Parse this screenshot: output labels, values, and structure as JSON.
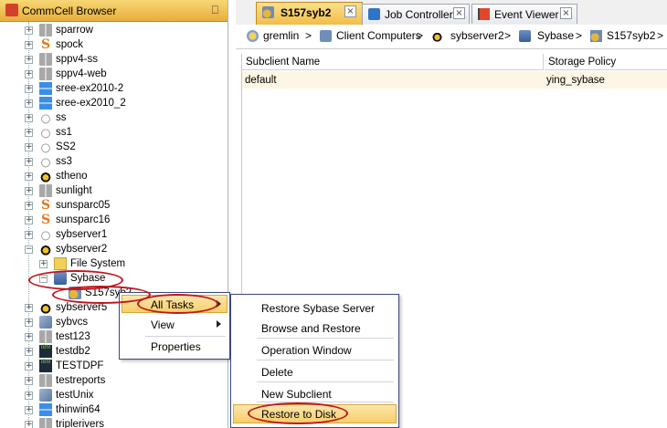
{
  "left_panel": {
    "title": "CommCell Browser",
    "pin": "⎕",
    "tree": [
      {
        "label": "sparrow",
        "icon": "grey-windows-icon"
      },
      {
        "label": "spock",
        "icon": "solaris-icon"
      },
      {
        "label": "sppv4-ss",
        "icon": "grey-windows-icon"
      },
      {
        "label": "sppv4-web",
        "icon": "grey-windows-icon"
      },
      {
        "label": "sree-ex2010-2",
        "icon": "windows-icon"
      },
      {
        "label": "sree-ex2010_2",
        "icon": "windows-icon"
      },
      {
        "label": "ss",
        "icon": "linux-grey-icon"
      },
      {
        "label": "ss1",
        "icon": "linux-grey-icon"
      },
      {
        "label": "SS2",
        "icon": "linux-grey-icon"
      },
      {
        "label": "ss3",
        "icon": "linux-grey-icon"
      },
      {
        "label": "stheno",
        "icon": "linux-icon"
      },
      {
        "label": "sunlight",
        "icon": "grey-windows-icon"
      },
      {
        "label": "sunsparc05",
        "icon": "solaris-icon"
      },
      {
        "label": "sunsparc16",
        "icon": "solaris-icon"
      },
      {
        "label": "sybserver1",
        "icon": "linux-grey-icon"
      },
      {
        "label": "sybserver2",
        "icon": "linux-icon"
      },
      {
        "label": "File System",
        "icon": "folder-icon"
      },
      {
        "label": "Sybase",
        "icon": "database-icon"
      },
      {
        "label": "S157syb2",
        "icon": "subclient-icon"
      },
      {
        "label": "sybserver5",
        "icon": "linux-icon"
      },
      {
        "label": "sybvcs",
        "icon": "network-icon"
      },
      {
        "label": "test123",
        "icon": "grey-windows-icon"
      },
      {
        "label": "testdb2",
        "icon": "ibm-icon"
      },
      {
        "label": "TESTDPF",
        "icon": "ibm-icon"
      },
      {
        "label": "testreports",
        "icon": "grey-windows-icon"
      },
      {
        "label": "testUnix",
        "icon": "network-icon"
      },
      {
        "label": "thinwin64",
        "icon": "windows-icon"
      },
      {
        "label": "triplerivers",
        "icon": "grey-windows-icon"
      }
    ]
  },
  "tabs": [
    {
      "label": "S157syb2",
      "icon": "subclient-icon",
      "active": true
    },
    {
      "label": "Job Controller",
      "icon": "play-icon",
      "active": false
    },
    {
      "label": "Event Viewer",
      "icon": "flag-icon",
      "active": false
    }
  ],
  "tab_close": "×",
  "breadcrumb": {
    "items": [
      "gremlin",
      "Client Computers",
      "sybserver2",
      "Sybase",
      "S157syb2"
    ],
    "separator": ">"
  },
  "table": {
    "columns": [
      "Subclient Name",
      "Storage Policy"
    ],
    "rows": [
      [
        "default",
        "ying_sybase"
      ]
    ]
  },
  "context_menu": {
    "items": [
      "All Tasks",
      "View",
      "Properties"
    ]
  },
  "submenu": {
    "items": [
      "Restore Sybase Server",
      "Browse and Restore",
      "Operation Window",
      "Delete",
      "New Subclient",
      "Restore to Disk"
    ]
  },
  "colors": {
    "title_bar": "#f2bd4a",
    "highlight_ellipse": "#c0151f",
    "menu_highlight": "#f7cf6b"
  }
}
